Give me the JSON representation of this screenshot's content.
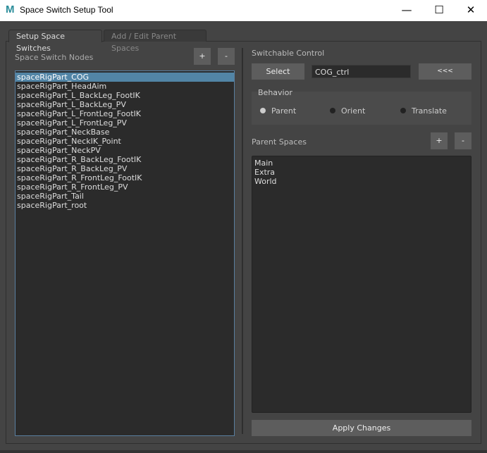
{
  "window": {
    "title": "Space Switch Setup Tool",
    "icon": "maya-icon",
    "controls": {
      "minimize": "—",
      "maximize": "☐",
      "close": "✕"
    }
  },
  "tabs": [
    {
      "label": "Setup Space Switches",
      "active": true
    },
    {
      "label": "Add / Edit Parent Spaces",
      "active": false
    }
  ],
  "left": {
    "heading": "Space Switch Nodes",
    "add": "+",
    "remove": "-",
    "nodes": [
      "spaceRigPart_COG",
      "spaceRigPart_HeadAim",
      "spaceRigPart_L_BackLeg_FootIK",
      "spaceRigPart_L_BackLeg_PV",
      "spaceRigPart_L_FrontLeg_FootIK",
      "spaceRigPart_L_FrontLeg_PV",
      "spaceRigPart_NeckBase",
      "spaceRigPart_NeckIK_Point",
      "spaceRigPart_NeckPV",
      "spaceRigPart_R_BackLeg_FootIK",
      "spaceRigPart_R_BackLeg_PV",
      "spaceRigPart_R_FrontLeg_FootIK",
      "spaceRigPart_R_FrontLeg_PV",
      "spaceRigPart_Tail",
      "spaceRigPart_root"
    ],
    "selected": "spaceRigPart_COG"
  },
  "right": {
    "heading": "Switchable Control",
    "select": "Select",
    "control_value": "COG_ctrl",
    "load": "<<<",
    "behavior": {
      "label": "Behavior",
      "options": [
        "Parent",
        "Orient",
        "Translate"
      ],
      "selected": "Parent"
    },
    "parent_spaces": {
      "label": "Parent Spaces",
      "add": "+",
      "remove": "-",
      "items": [
        "Main",
        "Extra",
        "World"
      ]
    },
    "apply": "Apply Changes"
  },
  "colors": {
    "selection": "#5285a6",
    "background": "#444444",
    "list_bg": "#2b2b2b",
    "button": "#5d5d5d"
  }
}
